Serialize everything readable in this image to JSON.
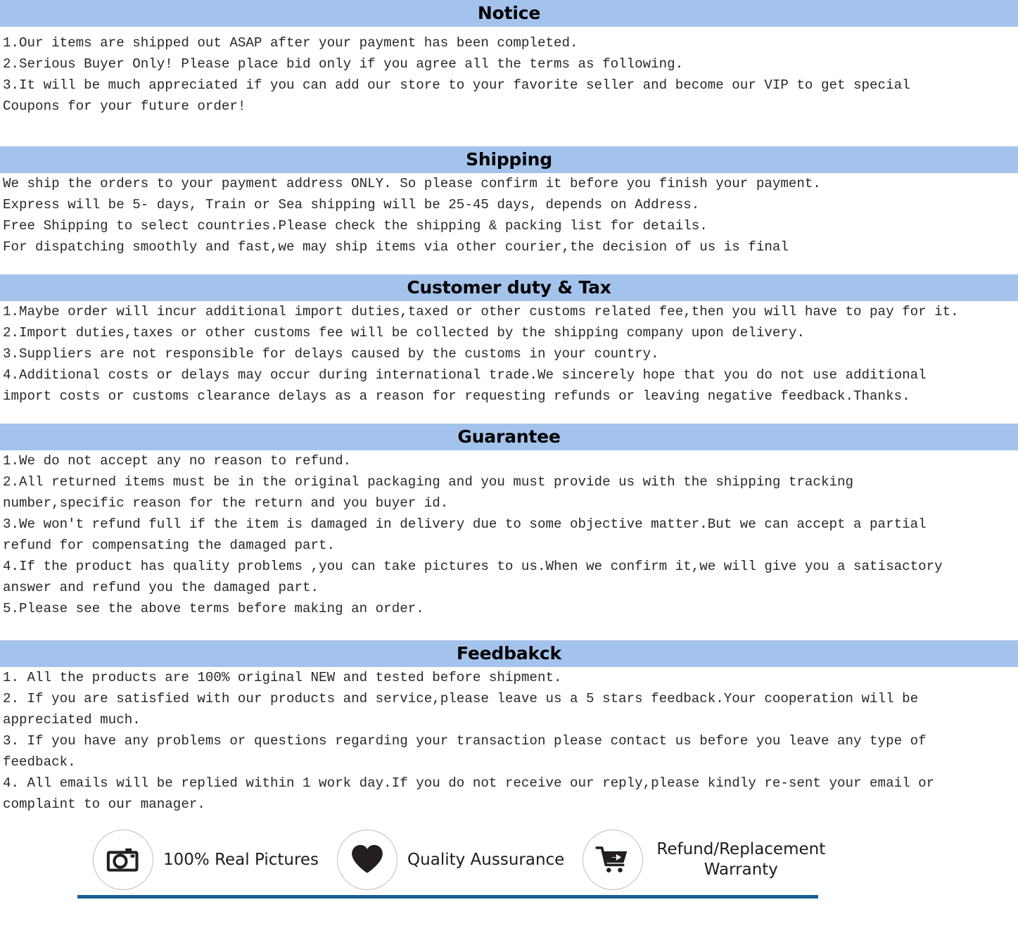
{
  "theme": {
    "band_color": "#a4c3ec",
    "rule_color": "#1a5e96",
    "text_color": "#282828"
  },
  "sections": [
    {
      "id": "notice",
      "title": "Notice",
      "lines": [
        "1.Our items are shipped out ASAP after your payment has been completed.",
        "2.Serious Buyer Only! Please place bid only if you agree all the terms as following.",
        "3.It will be much appreciated if you can add our store to your favorite seller and become our VIP to get special",
        "Coupons for your future order!"
      ]
    },
    {
      "id": "shipping",
      "title": "Shipping",
      "lines": [
        "We ship the orders to your payment address ONLY. So please confirm it before you finish your payment.",
        "Express will be 5- days, Train or Sea shipping will be 25-45 days, depends on Address.",
        "Free Shipping to select countries.Please check the shipping & packing list for details.",
        "For dispatching smoothly and fast,we may ship items via other courier,the decision of us is final"
      ]
    },
    {
      "id": "customer-duty-tax",
      "title": "Customer duty & Tax",
      "lines": [
        "1.Maybe order will incur additional import duties,taxed or other customs related fee,then you will have to pay for it.",
        "2.Import duties,taxes or other customs fee will be collected by the shipping company upon delivery.",
        "3.Suppliers are not responsible for delays caused by the customs in your country.",
        "4.Additional costs or delays may occur during international trade.We sincerely hope that you do not use additional",
        "import costs or customs clearance delays as a reason for requesting refunds or leaving negative feedback.Thanks."
      ]
    },
    {
      "id": "guarantee",
      "title": "Guarantee",
      "lines": [
        "1.We do not accept any no reason to refund.",
        "2.All returned items must be in the original packaging and you must provide us with the shipping tracking",
        "number,specific reason for the return and you buyer id.",
        "3.We won't refund full if the item is damaged in delivery due to some objective matter.But we can accept a partial",
        "refund for compensating the damaged part.",
        "4.If the product has quality problems ,you can take pictures to us.When we confirm it,we will give you a satisactory",
        "answer and refund you the damaged part.",
        "5.Please see the above terms before making an order."
      ]
    },
    {
      "id": "feedback",
      "title": "Feedbakck",
      "lines": [
        "1. All the products are 100% original NEW and tested before shipment.",
        "2. If you are satisfied with our products and service,please leave us a 5 stars feedback.Your cooperation will be",
        "appreciated much.",
        "3. If you have any problems or questions regarding your transaction please contact us before you leave any type of",
        "feedback.",
        "4. All emails will be replied within 1 work day.If you do not receive our reply,please kindly re-sent your email or",
        "complaint to our manager."
      ]
    }
  ],
  "footer": {
    "badges": [
      {
        "icon": "camera-icon",
        "label": "100% Real Pictures"
      },
      {
        "icon": "heart-icon",
        "label": "Quality Aussurance"
      },
      {
        "icon": "shopping-cart-icon",
        "label": "Refund/Replacement Warranty"
      }
    ]
  }
}
